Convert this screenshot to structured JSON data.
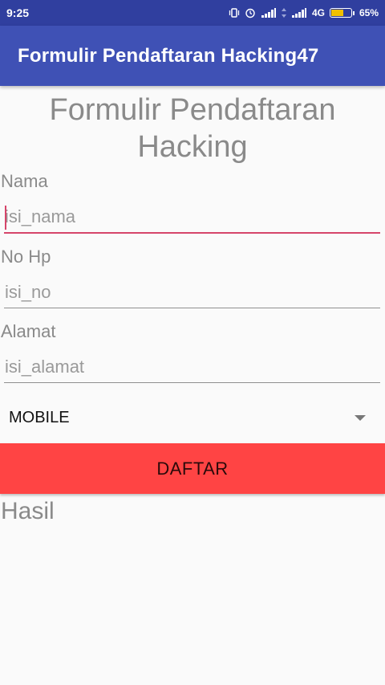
{
  "status_bar": {
    "time": "9:25",
    "network": "4G",
    "battery": "65%",
    "battery_level": 0.65,
    "icons": [
      "vibrate-icon",
      "alarm-icon",
      "signal-icon",
      "data-arrows-icon",
      "signal-icon",
      "battery-icon"
    ]
  },
  "app_bar": {
    "title": "Formulir Pendaftaran Hacking47",
    "color": "#3f51b5"
  },
  "form": {
    "heading": "Formulir Pendaftaran Hacking",
    "nama_label": "Nama",
    "nama_placeholder": "isi_nama",
    "nohp_label": "No Hp",
    "nohp_placeholder": "isi_no",
    "alamat_label": "Alamat",
    "alamat_placeholder": "isi_alamat",
    "spinner_value": "MOBILE",
    "submit_label": "DAFTAR",
    "submit_color": "#ff4444",
    "result_label": "Hasil",
    "accent_color": "#d6456a"
  }
}
